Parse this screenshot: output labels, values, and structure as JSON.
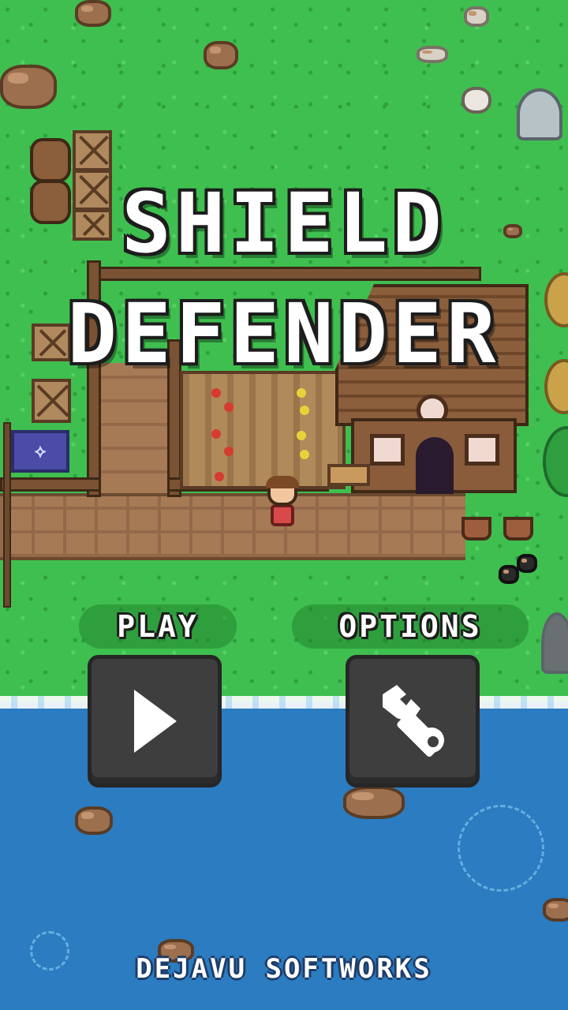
{
  "game": {
    "title_line1": "SHIELD",
    "title_line2": "DEFENDER"
  },
  "menu": {
    "play_label": "PLAY",
    "options_label": "OPTIONS",
    "play_icon": "play-icon",
    "options_icon": "wrench-icon"
  },
  "footer": {
    "developer": "DEJAVU SOFTWORKS"
  },
  "colors": {
    "grass": "#3fbf4f",
    "water": "#2b7cc0",
    "button_bg": "#3e3e3e",
    "title_text": "#ffffff",
    "title_outline": "#1d1d1d"
  }
}
